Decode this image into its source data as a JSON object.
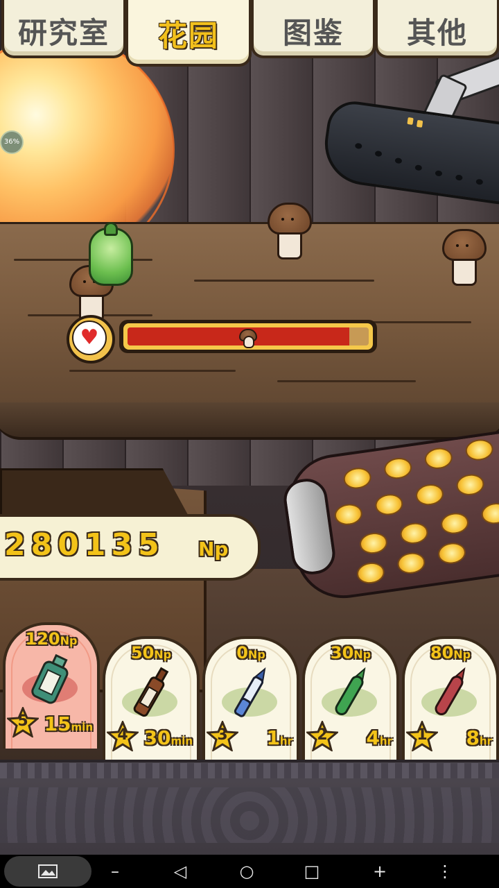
{
  "tabs": [
    {
      "label": "研究室",
      "active": false
    },
    {
      "label": "花园",
      "active": true
    },
    {
      "label": "图鉴",
      "active": false
    },
    {
      "label": "其他",
      "active": false
    }
  ],
  "progress_badge": "36%",
  "health_bar": {
    "fill_fraction": 0.92,
    "color": "#c8281a"
  },
  "np_counter": {
    "value": "280135",
    "unit": "Np"
  },
  "items": [
    {
      "price": "120",
      "unit": "Np",
      "stars": "5",
      "time": "15",
      "time_unit": "min",
      "icon": "green-bottle-icon",
      "selected": true
    },
    {
      "price": "50",
      "unit": "Np",
      "stars": "4",
      "time": "30",
      "time_unit": "min",
      "icon": "brown-vial-icon",
      "selected": false
    },
    {
      "price": "0",
      "unit": "Np",
      "stars": "3",
      "time": "1",
      "time_unit": "hr",
      "icon": "blue-pen-icon",
      "selected": false
    },
    {
      "price": "30",
      "unit": "Np",
      "stars": "2",
      "time": "4",
      "time_unit": "hr",
      "icon": "green-ampoule-icon",
      "selected": false
    },
    {
      "price": "80",
      "unit": "Np",
      "stars": "1",
      "time": "8",
      "time_unit": "hr",
      "icon": "red-ampoule-icon",
      "selected": false
    }
  ],
  "colors": {
    "accent_yellow": "#f3c319",
    "outline": "#3a2a1a",
    "card_bg": "#faf6e4",
    "card_selected_bg": "#f7b7a8"
  }
}
